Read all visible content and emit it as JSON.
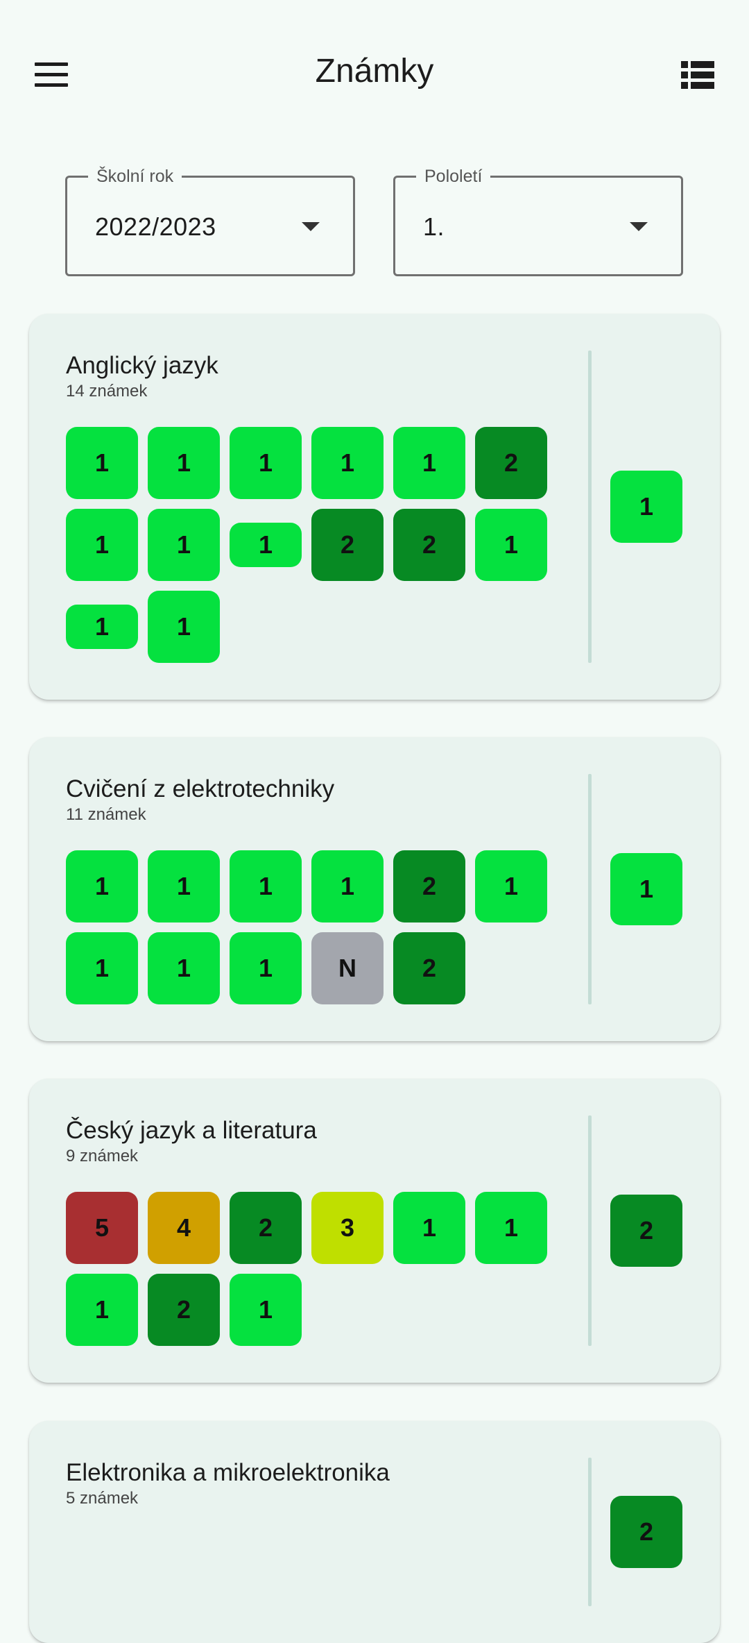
{
  "header": {
    "title": "Známky"
  },
  "filters": {
    "year": {
      "label": "Školní rok",
      "value": "2022/2023"
    },
    "term": {
      "label": "Pololetí",
      "value": "1."
    }
  },
  "colors": {
    "1": "#05e13f",
    "2": "#078a23",
    "3": "#bfdf00",
    "4": "#d0a000",
    "5": "#a82f31",
    "N": "#a3a6ad"
  },
  "subjects": [
    {
      "name": "Anglický jazyk",
      "count": "14 známek",
      "final": "1",
      "grades": [
        {
          "v": "1"
        },
        {
          "v": "1"
        },
        {
          "v": "1"
        },
        {
          "v": "1"
        },
        {
          "v": "1"
        },
        {
          "v": "2"
        },
        {
          "v": "1"
        },
        {
          "v": "1"
        },
        {
          "v": "1",
          "small": true
        },
        {
          "v": "2"
        },
        {
          "v": "2"
        },
        {
          "v": "1"
        },
        {
          "v": "1",
          "small": true
        },
        {
          "v": "1"
        }
      ]
    },
    {
      "name": "Cvičení z elektrotechniky",
      "count": "11 známek",
      "final": "1",
      "grades": [
        {
          "v": "1"
        },
        {
          "v": "1"
        },
        {
          "v": "1"
        },
        {
          "v": "1"
        },
        {
          "v": "2"
        },
        {
          "v": "1"
        },
        {
          "v": "1"
        },
        {
          "v": "1"
        },
        {
          "v": "1"
        },
        {
          "v": "N"
        },
        {
          "v": "2"
        }
      ]
    },
    {
      "name": "Český jazyk a literatura",
      "count": "9 známek",
      "final": "2",
      "grades": [
        {
          "v": "5"
        },
        {
          "v": "4"
        },
        {
          "v": "2"
        },
        {
          "v": "3"
        },
        {
          "v": "1"
        },
        {
          "v": "1"
        },
        {
          "v": "1"
        },
        {
          "v": "2"
        },
        {
          "v": "1"
        }
      ]
    },
    {
      "name": "Elektronika a mikroelektronika",
      "count": "5 známek",
      "final": "2",
      "grades": []
    }
  ]
}
